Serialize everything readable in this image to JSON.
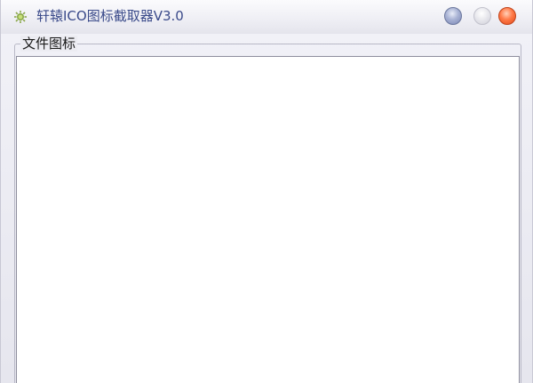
{
  "window": {
    "title": "轩辕ICO图标截取器V3.0",
    "app_icon": "gear-bug-icon",
    "controls": {
      "minimize": "minimize-icon",
      "maximize": "maximize-icon",
      "close": "close-icon"
    }
  },
  "group": {
    "label": "文件图标"
  },
  "colors": {
    "title_text": "#3a4a8a",
    "minimize": "#8a96c4",
    "maximize": "#e0e0e6",
    "close": "#f06030"
  }
}
